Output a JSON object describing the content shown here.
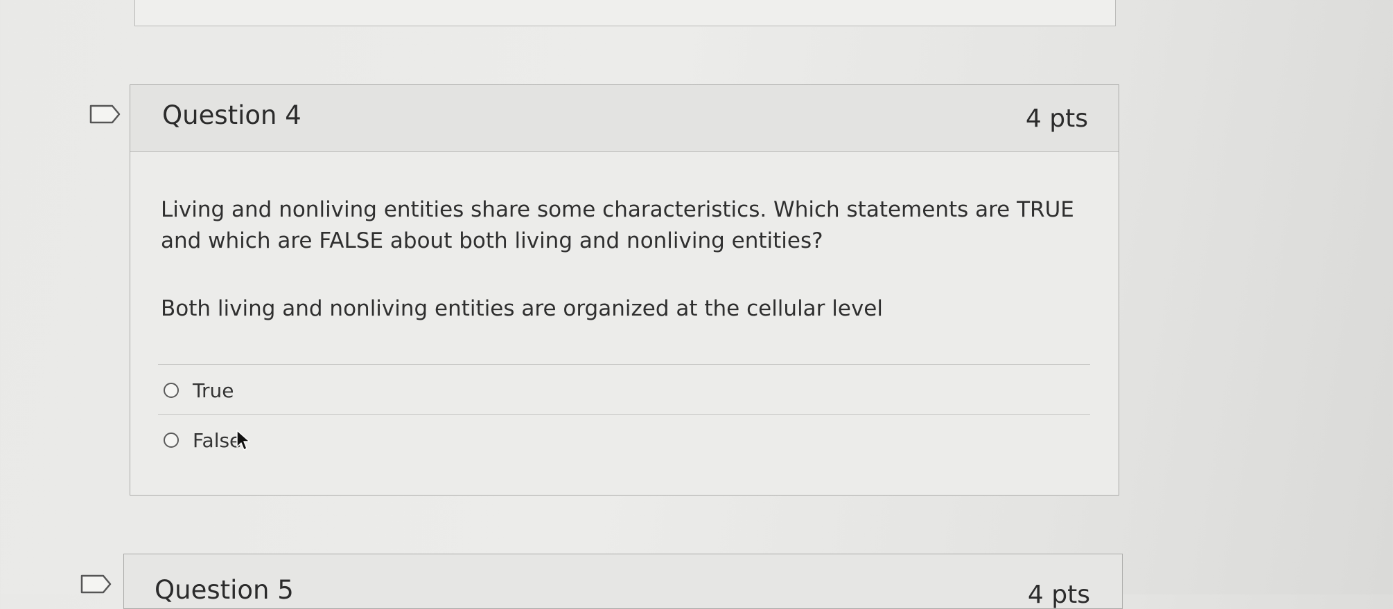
{
  "question": {
    "title": "Question 4",
    "points": "4 pts",
    "prompt": "Living and nonliving entities share some characteristics. Which statements are TRUE and which are FALSE about both living and nonliving entities?",
    "statement": "Both living and nonliving entities are organized at the cellular level",
    "answers": [
      {
        "label": "True",
        "selected": false
      },
      {
        "label": "False",
        "selected": false
      }
    ]
  },
  "next_question": {
    "title": "Question 5",
    "points": "4 pts"
  },
  "icons": {
    "flag": "flag-question-icon",
    "cursor": "mouse-pointer-icon"
  }
}
